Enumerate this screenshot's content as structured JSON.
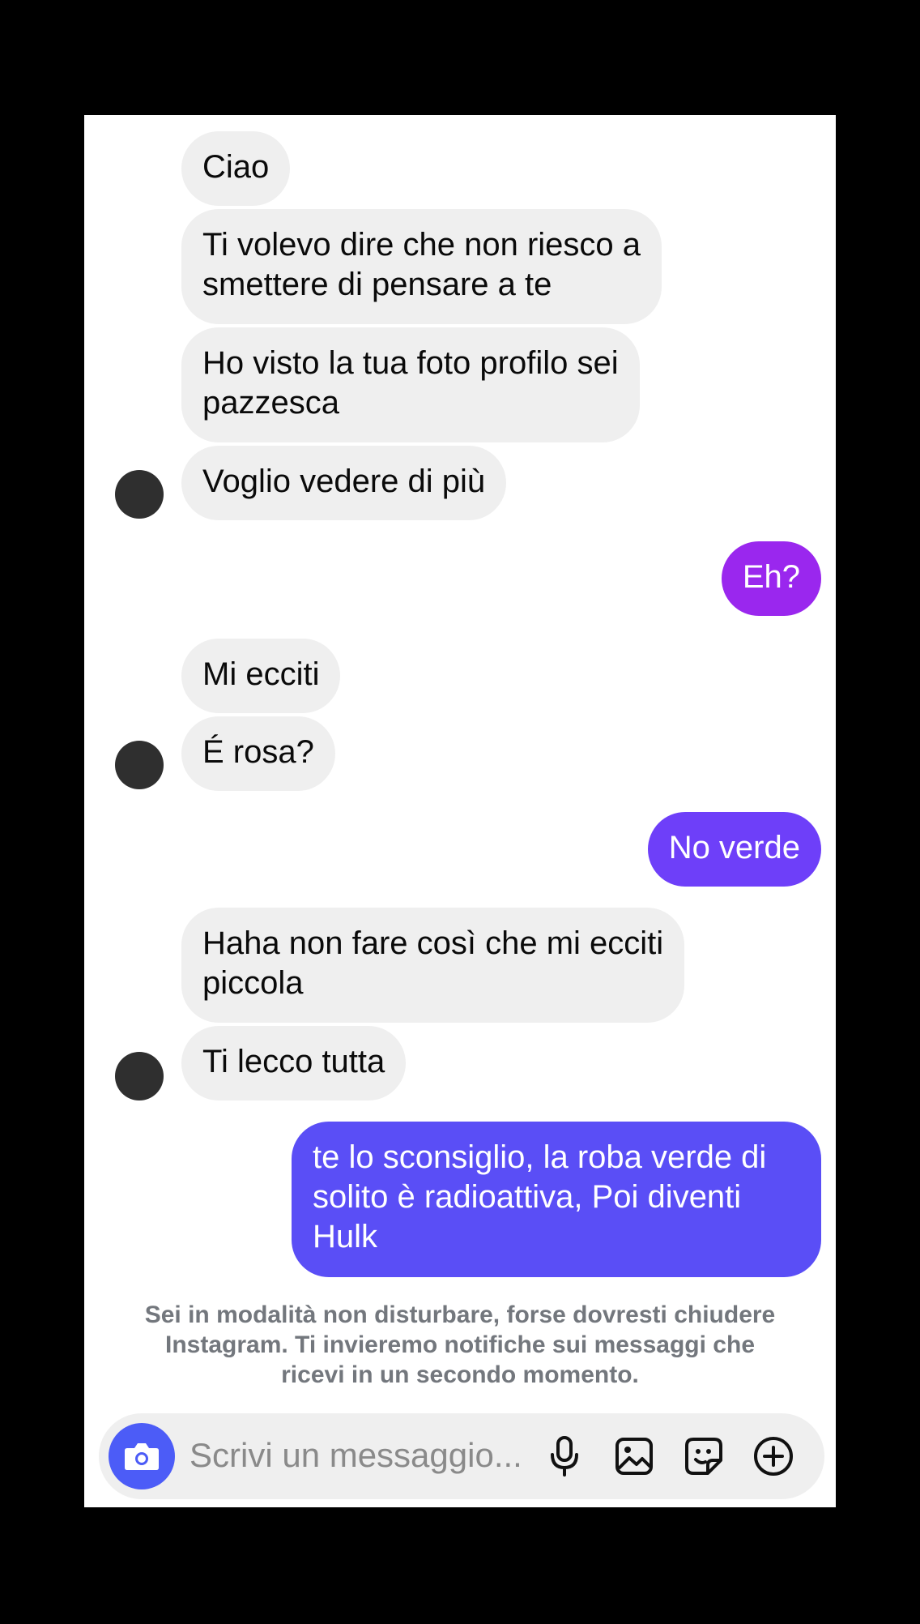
{
  "colors": {
    "incoming_bubble": "#efefef",
    "outgoing_1": "#9a27ee",
    "outgoing_2": "#6e3ff9",
    "outgoing_3": "#5a4ef6",
    "camera_button": "#4c5cf7",
    "notice_text": "#73777d",
    "page_background": "#000000"
  },
  "messages": [
    {
      "from": "them",
      "text": "Ciao"
    },
    {
      "from": "them",
      "text": "Ti volevo dire che non riesco a\nsmettere di pensare a te"
    },
    {
      "from": "them",
      "text": "Ho visto la tua foto profilo sei\npazzesca"
    },
    {
      "from": "them",
      "text": "Voglio vedere di più"
    },
    {
      "from": "me",
      "text": "Eh?"
    },
    {
      "from": "them",
      "text": "Mi ecciti"
    },
    {
      "from": "them",
      "text": "É rosa?"
    },
    {
      "from": "me",
      "text": "No verde"
    },
    {
      "from": "them",
      "text": "Haha non fare così che mi ecciti\npiccola"
    },
    {
      "from": "them",
      "text": "Ti lecco tutta"
    },
    {
      "from": "me",
      "text": "te lo sconsiglio, la roba verde di\nsolito è radioattiva,  Poi diventi\nHulk"
    }
  ],
  "dnd_notice": "Sei in modalità non disturbare, forse dovresti chiudere\nInstagram. Ti invieremo notifiche sui messaggi che\nricevi in un secondo momento.",
  "composer": {
    "placeholder": "Scrivi un messaggio...",
    "icons": [
      "camera-icon",
      "microphone-icon",
      "gallery-icon",
      "sticker-icon",
      "add-icon"
    ]
  }
}
